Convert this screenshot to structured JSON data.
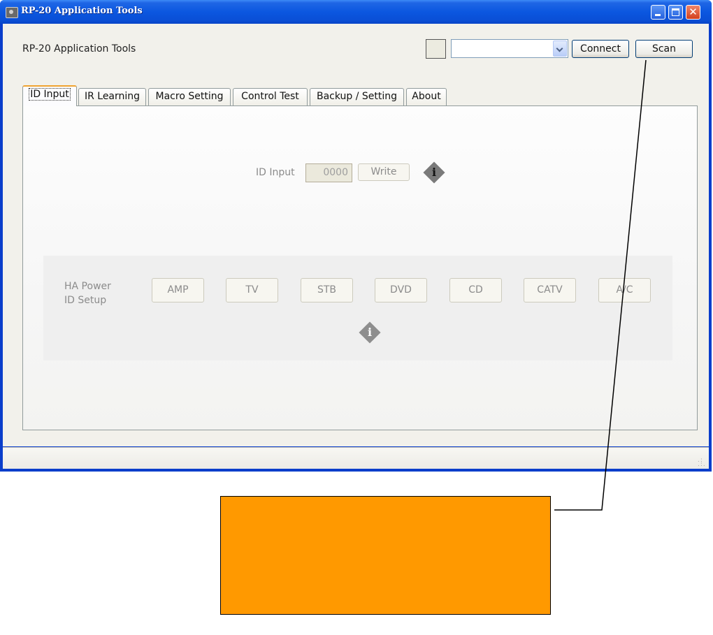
{
  "window": {
    "title": "RP-20 Application Tools",
    "icon": "app-window-icon"
  },
  "header": {
    "app_title": "RP-20 Application Tools",
    "port_select_value": "",
    "connect_label": "Connect",
    "scan_label": "Scan"
  },
  "tabs": [
    {
      "label": "ID Input",
      "active": true
    },
    {
      "label": "IR Learning",
      "active": false
    },
    {
      "label": "Macro Setting",
      "active": false
    },
    {
      "label": "Control Test",
      "active": false
    },
    {
      "label": "Backup / Setting",
      "active": false
    },
    {
      "label": "About",
      "active": false
    }
  ],
  "id_input": {
    "label": "ID Input",
    "value": "0000",
    "write_label": "Write",
    "info_icon": "info-icon"
  },
  "ha_power": {
    "label_line1": "HA Power",
    "label_line2": "ID Setup",
    "buttons": [
      "AMP",
      "TV",
      "STB",
      "DVD",
      "CD",
      "CATV",
      "A/C"
    ],
    "info_icon": "info-icon"
  },
  "colors": {
    "titlebar": "#0b57e0",
    "callout_fill": "#ff9900",
    "active_tab_accent": "#f0a330"
  }
}
